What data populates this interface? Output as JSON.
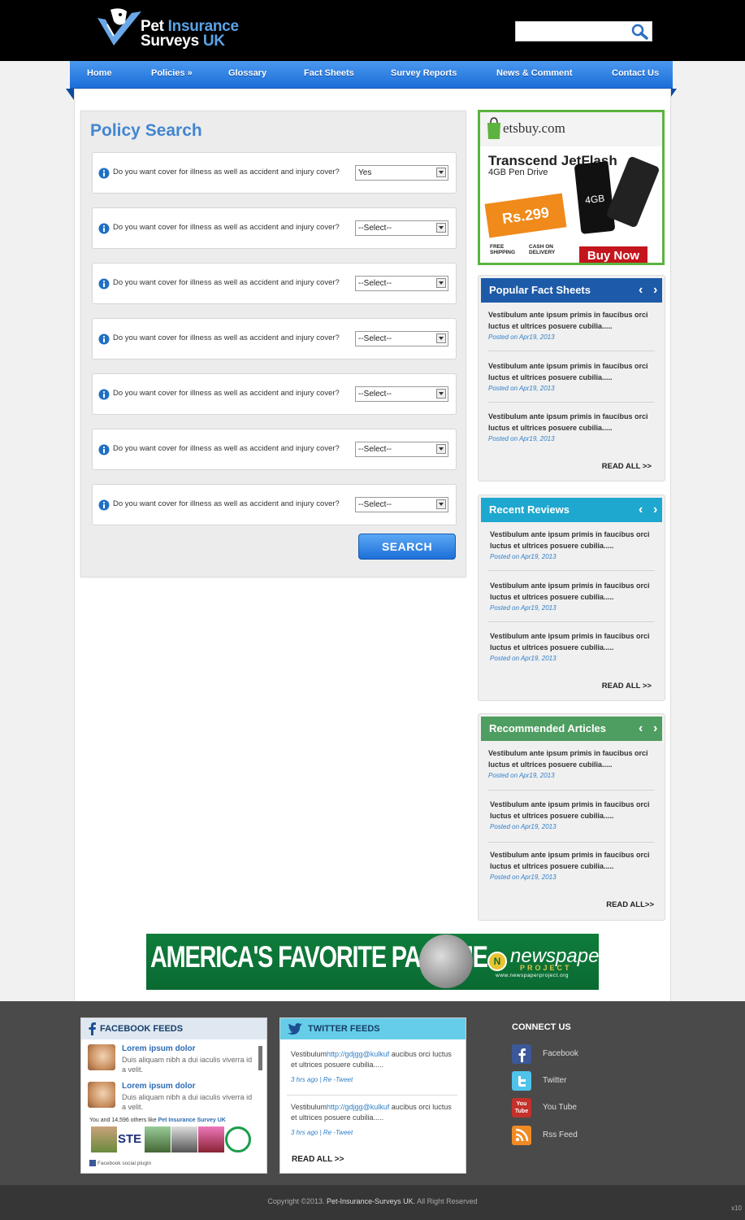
{
  "header": {
    "logo_line1_a": "Pet ",
    "logo_line1_b": "Insurance",
    "logo_line2_a": "Surveys ",
    "logo_line2_b": "UK",
    "search_placeholder": ""
  },
  "nav": {
    "items": [
      {
        "label": "Home"
      },
      {
        "label": "Policies »"
      },
      {
        "label": "Glossary"
      },
      {
        "label": "Fact Sheets"
      },
      {
        "label": "Survey Reports"
      },
      {
        "label": "News & Comment"
      },
      {
        "label": "Contact Us"
      }
    ]
  },
  "policy": {
    "title": "Policy Search",
    "questions": [
      {
        "text": "Do you want cover for illness as well as accident and injury cover?",
        "value": "Yes"
      },
      {
        "text": "Do you want cover for illness as well as accident and injury cover?",
        "value": "--Select--"
      },
      {
        "text": "Do you want cover for illness as well as accident and injury cover?",
        "value": "--Select--"
      },
      {
        "text": "Do you want cover for illness as well as accident and injury cover?",
        "value": "--Select--"
      },
      {
        "text": "Do you want cover for illness as well as accident and injury cover?",
        "value": "--Select--"
      },
      {
        "text": "Do you want cover for illness as well as accident and injury cover?",
        "value": "--Select--"
      },
      {
        "text": "Do you want cover for illness as well as accident and injury cover?",
        "value": "--Select--"
      }
    ],
    "search_label": "SEARCH"
  },
  "ad_side": {
    "brand": "etsbuy.com",
    "product": "Transcend JetFlash",
    "product_sub": "4GB Pen Drive",
    "price": "Rs.299",
    "usb_label": "4GB",
    "free_shipping": "FREE\nSHIPPING",
    "cod": "CASH ON\nDELIVERY",
    "buy_now": "Buy Now"
  },
  "widgets": [
    {
      "title": "Popular Fact Sheets",
      "color": "#1d5aa8",
      "items": [
        {
          "text": "Vestibulum ante ipsum primis in faucibus orci luctus et ultrices posuere cubilia.....",
          "date": "Posted on Apr19, 2013"
        },
        {
          "text": "Vestibulum ante ipsum primis in faucibus orci luctus et ultrices posuere cubilia.....",
          "date": "Posted on Apr19, 2013"
        },
        {
          "text": "Vestibulum ante ipsum primis in faucibus orci luctus et ultrices posuere cubilia.....",
          "date": "Posted on Apr19, 2013"
        }
      ],
      "read_all": "READ ALL >>"
    },
    {
      "title": "Recent Reviews",
      "color": "#1fa8cf",
      "items": [
        {
          "text": "Vestibulum ante ipsum primis in faucibus orci luctus et ultrices posuere cubilia.....",
          "date": "Posted on Apr19, 2013"
        },
        {
          "text": "Vestibulum ante ipsum primis in faucibus orci luctus et ultrices posuere cubilia.....",
          "date": "Posted on Apr19, 2013"
        },
        {
          "text": "Vestibulum ante ipsum primis in faucibus orci luctus et ultrices posuere cubilia.....",
          "date": "Posted on Apr19, 2013"
        }
      ],
      "read_all": "READ ALL >>"
    },
    {
      "title": "Recommended Articles",
      "color": "#4f9e61",
      "items": [
        {
          "text": "Vestibulum ante ipsum primis in faucibus orci luctus et ultrices posuere cubilia.....",
          "date": "Posted on Apr19, 2013"
        },
        {
          "text": "Vestibulum ante ipsum primis in faucibus orci luctus et ultrices posuere cubilia.....",
          "date": "Posted on Apr19, 2013"
        },
        {
          "text": "Vestibulum ante ipsum primis in faucibus orci luctus et ultrices posuere cubilia.....",
          "date": "Posted on Apr19, 2013"
        }
      ],
      "read_all": "READ ALL>>"
    }
  ],
  "banner": {
    "headline": "AMERICA'S FAVORITE PASTIME",
    "brand": "newspaper",
    "brand_sub": "PROJECT",
    "url": "www.newspaperproject.org"
  },
  "footer": {
    "facebook": {
      "title": "FACEBOOK FEEDS",
      "posts": [
        {
          "title": "Lorem ipsum dolor",
          "text": "Duis aliquam nibh a dui iaculis viverra id a velit."
        },
        {
          "title": "Lorem ipsum dolor",
          "text": "Duis aliquam nibh a dui iaculis viverra id a velit."
        }
      ],
      "likes_prefix": "You and 14,596 others like ",
      "likes_page": "Pet Insurance Survey UK",
      "plugin": "Facebook social plugin"
    },
    "twitter": {
      "title": "TWITTER FEEDS",
      "tweets": [
        {
          "pre": "Vestibulum",
          "link": "http://gdjgg@kulkuf",
          "post": "  aucibus orci luctus  et ultrices posuere cubilia.....",
          "meta": "3 hrs ago  |  Re -Tweet"
        },
        {
          "pre": "Vestibulum",
          "link": "http://gdjgg@kulkuf",
          "post": "  aucibus orci luctus  et ultrices posuere cubilia.....",
          "meta": "3 hrs ago  |  Re -Tweet"
        }
      ],
      "read_all": "READ ALL >>"
    },
    "connect": {
      "title": "CONNECT US",
      "links": [
        {
          "label": "Facebook",
          "icon": "facebook-icon",
          "color": "#3b5998"
        },
        {
          "label": "Twitter",
          "icon": "twitter-icon",
          "color": "#4fc3e9"
        },
        {
          "label": "You Tube",
          "icon": "youtube-icon",
          "color": "#c4302b"
        },
        {
          "label": "Rss Feed",
          "icon": "rss-icon",
          "color": "#f08a24"
        }
      ]
    }
  },
  "copyright": {
    "prefix": "Copyright ©2013. ",
    "site": "Pet-Insurance-Surveys UK.",
    "suffix": " All Right Reserved"
  },
  "corner_mark": "x10"
}
